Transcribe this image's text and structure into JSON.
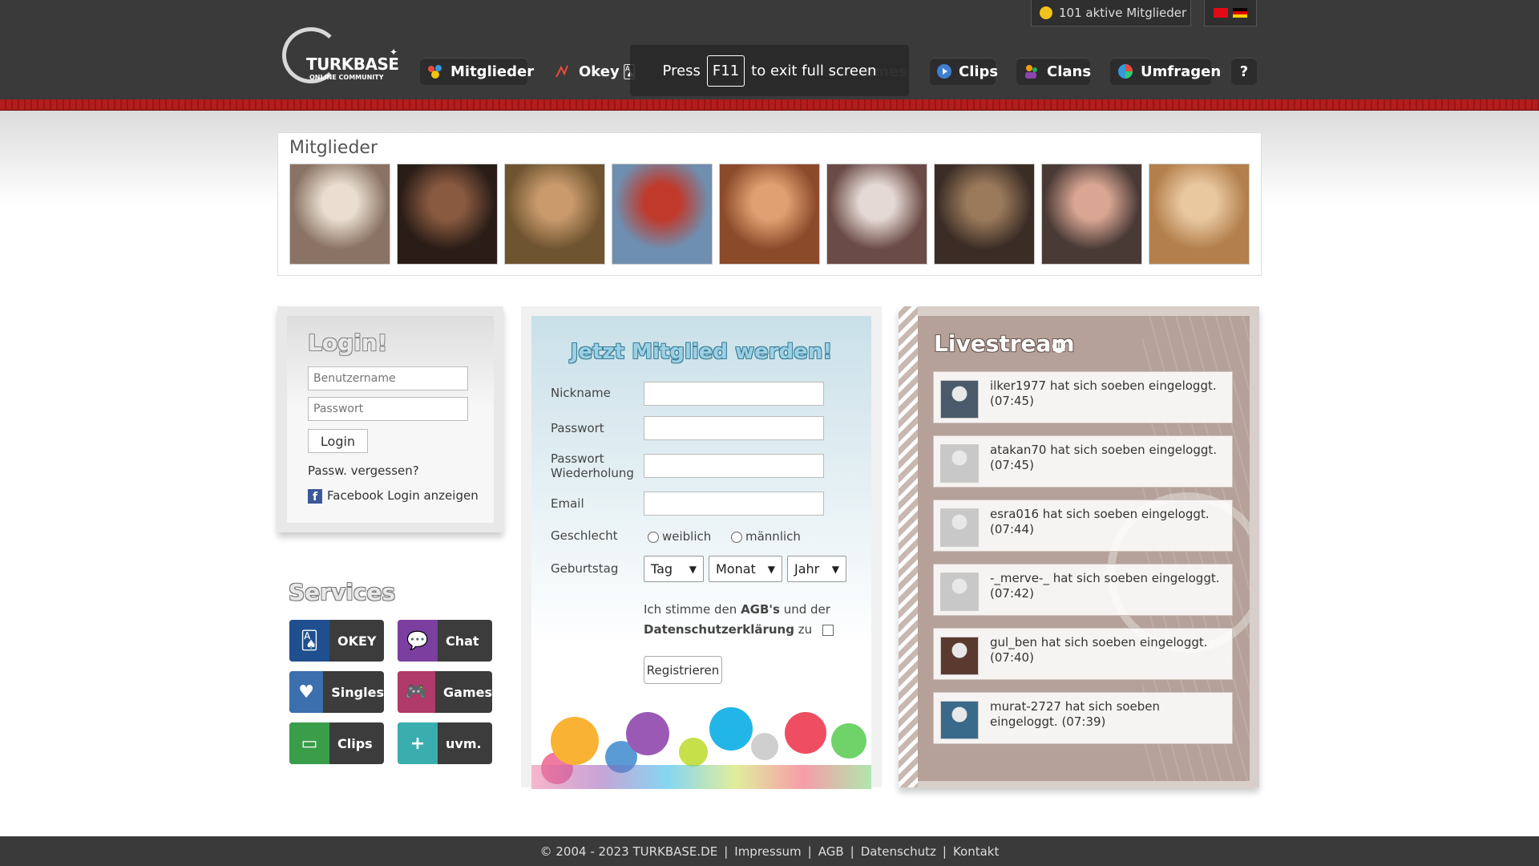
{
  "header": {
    "logo": {
      "name": "TURKBASE",
      "sub": "ONLINE COMMUNITY"
    },
    "nav": [
      {
        "label": "Mitglieder",
        "icon": "members-icon"
      },
      {
        "label": "Okey",
        "icon": "okey-cards-icon"
      },
      {
        "label": "Clips",
        "icon": "play-icon"
      },
      {
        "label": "Clans",
        "icon": "clans-icon"
      },
      {
        "label": "Umfragen",
        "icon": "poll-icon"
      },
      {
        "label": "?",
        "icon": "help-icon"
      }
    ],
    "partially_hidden_nav": "ames",
    "fullscreen_hint": {
      "pre": "Press",
      "key": "F11",
      "post": "to exit full screen"
    },
    "active_members": "101 aktive Mitglieder",
    "languages": [
      "tr",
      "de"
    ]
  },
  "members": {
    "title": "Mitglieder",
    "photos": [
      {
        "colors": [
          "#8a7364",
          "#e9ded0"
        ]
      },
      {
        "colors": [
          "#2a1d17",
          "#8a5a40"
        ]
      },
      {
        "colors": [
          "#6f5430",
          "#c89a6c"
        ]
      },
      {
        "colors": [
          "#6f8fb0",
          "#c0392b"
        ]
      },
      {
        "colors": [
          "#8b4a2a",
          "#e1a071"
        ]
      },
      {
        "colors": [
          "#6b4b45",
          "#e5d9d5"
        ]
      },
      {
        "colors": [
          "#3b2d26",
          "#9b7a5b"
        ]
      },
      {
        "colors": [
          "#4a3a36",
          "#d9a693"
        ]
      },
      {
        "colors": [
          "#b37f4c",
          "#e9c8a0"
        ]
      }
    ]
  },
  "login": {
    "title": "Login!",
    "username_placeholder": "Benutzername",
    "password_placeholder": "Passwort",
    "button": "Login",
    "forgot": "Passw. vergessen?",
    "facebook": "Facebook Login anzeigen"
  },
  "services": {
    "title": "Services",
    "items": [
      {
        "label": "OKEY",
        "icon": "okey-cards-icon",
        "color": "#1f4f8f"
      },
      {
        "label": "Chat",
        "icon": "chat-bubble-icon",
        "color": "#7b3fa0"
      },
      {
        "label": "Singles",
        "icon": "heart-icon",
        "color": "#3c6fae"
      },
      {
        "label": "Games",
        "icon": "gamepad-icon",
        "color": "#b03a6a"
      },
      {
        "label": "Clips",
        "icon": "screen-icon",
        "color": "#3a9d4a"
      },
      {
        "label": "uvm.",
        "icon": "plus-icon",
        "color": "#3aaeae"
      }
    ]
  },
  "register": {
    "title": "Jetzt Mitglied werden!",
    "labels": {
      "nickname": "Nickname",
      "password": "Passwort",
      "password_repeat": "Passwort Wiederholung",
      "email": "Email",
      "gender": "Geschlecht",
      "birthday": "Geburtstag"
    },
    "gender_options": [
      "weiblich",
      "männlich"
    ],
    "birthday_selects": [
      "Tag",
      "Monat",
      "Jahr"
    ],
    "agree": {
      "pre": "Ich stimme den",
      "agb": "AGB's",
      "mid": "und der",
      "privacy": "Datenschutzerklärung",
      "post": "zu"
    },
    "button": "Registrieren"
  },
  "livestream": {
    "title": "Livestream",
    "items": [
      {
        "text": "ilker1977 hat sich soeben eingeloggt. (07:45)",
        "avatar_color": "#4a5a6a"
      },
      {
        "text": "atakan70 hat sich soeben eingeloggt. (07:45)",
        "avatar_color": "#c8c8c8"
      },
      {
        "text": "esra016 hat sich soeben eingeloggt. (07:44)",
        "avatar_color": "#c8c8c8"
      },
      {
        "text": "-_merve-_ hat sich soeben eingeloggt. (07:42)",
        "avatar_color": "#c8c8c8"
      },
      {
        "text": "gul_ben hat sich soeben eingeloggt. (07:40)",
        "avatar_color": "#5a3a2e"
      },
      {
        "text": "murat-2727 hat sich soeben eingeloggt. (07:39)",
        "avatar_color": "#3a6a8a"
      }
    ]
  },
  "footer": {
    "copyright": "© 2004 - 2023 TURKBASE.DE",
    "links": [
      "Impressum",
      "AGB",
      "Datenschutz",
      "Kontakt"
    ]
  }
}
